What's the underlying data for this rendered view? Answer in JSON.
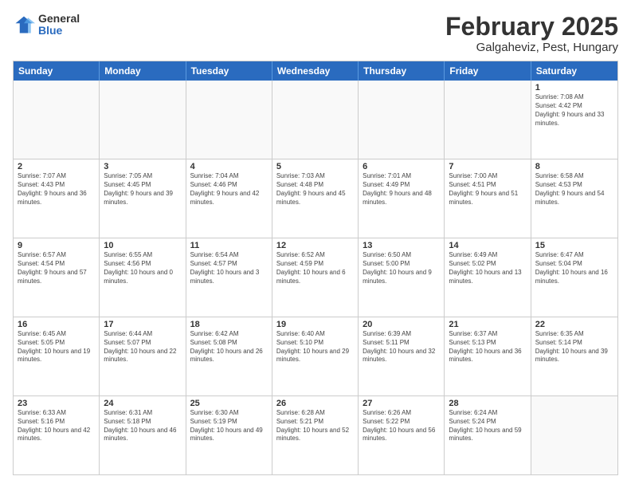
{
  "logo": {
    "general": "General",
    "blue": "Blue"
  },
  "title": "February 2025",
  "location": "Galgaheviz, Pest, Hungary",
  "days_of_week": [
    "Sunday",
    "Monday",
    "Tuesday",
    "Wednesday",
    "Thursday",
    "Friday",
    "Saturday"
  ],
  "weeks": [
    [
      {
        "day": "",
        "info": ""
      },
      {
        "day": "",
        "info": ""
      },
      {
        "day": "",
        "info": ""
      },
      {
        "day": "",
        "info": ""
      },
      {
        "day": "",
        "info": ""
      },
      {
        "day": "",
        "info": ""
      },
      {
        "day": "1",
        "info": "Sunrise: 7:08 AM\nSunset: 4:42 PM\nDaylight: 9 hours and 33 minutes."
      }
    ],
    [
      {
        "day": "2",
        "info": "Sunrise: 7:07 AM\nSunset: 4:43 PM\nDaylight: 9 hours and 36 minutes."
      },
      {
        "day": "3",
        "info": "Sunrise: 7:05 AM\nSunset: 4:45 PM\nDaylight: 9 hours and 39 minutes."
      },
      {
        "day": "4",
        "info": "Sunrise: 7:04 AM\nSunset: 4:46 PM\nDaylight: 9 hours and 42 minutes."
      },
      {
        "day": "5",
        "info": "Sunrise: 7:03 AM\nSunset: 4:48 PM\nDaylight: 9 hours and 45 minutes."
      },
      {
        "day": "6",
        "info": "Sunrise: 7:01 AM\nSunset: 4:49 PM\nDaylight: 9 hours and 48 minutes."
      },
      {
        "day": "7",
        "info": "Sunrise: 7:00 AM\nSunset: 4:51 PM\nDaylight: 9 hours and 51 minutes."
      },
      {
        "day": "8",
        "info": "Sunrise: 6:58 AM\nSunset: 4:53 PM\nDaylight: 9 hours and 54 minutes."
      }
    ],
    [
      {
        "day": "9",
        "info": "Sunrise: 6:57 AM\nSunset: 4:54 PM\nDaylight: 9 hours and 57 minutes."
      },
      {
        "day": "10",
        "info": "Sunrise: 6:55 AM\nSunset: 4:56 PM\nDaylight: 10 hours and 0 minutes."
      },
      {
        "day": "11",
        "info": "Sunrise: 6:54 AM\nSunset: 4:57 PM\nDaylight: 10 hours and 3 minutes."
      },
      {
        "day": "12",
        "info": "Sunrise: 6:52 AM\nSunset: 4:59 PM\nDaylight: 10 hours and 6 minutes."
      },
      {
        "day": "13",
        "info": "Sunrise: 6:50 AM\nSunset: 5:00 PM\nDaylight: 10 hours and 9 minutes."
      },
      {
        "day": "14",
        "info": "Sunrise: 6:49 AM\nSunset: 5:02 PM\nDaylight: 10 hours and 13 minutes."
      },
      {
        "day": "15",
        "info": "Sunrise: 6:47 AM\nSunset: 5:04 PM\nDaylight: 10 hours and 16 minutes."
      }
    ],
    [
      {
        "day": "16",
        "info": "Sunrise: 6:45 AM\nSunset: 5:05 PM\nDaylight: 10 hours and 19 minutes."
      },
      {
        "day": "17",
        "info": "Sunrise: 6:44 AM\nSunset: 5:07 PM\nDaylight: 10 hours and 22 minutes."
      },
      {
        "day": "18",
        "info": "Sunrise: 6:42 AM\nSunset: 5:08 PM\nDaylight: 10 hours and 26 minutes."
      },
      {
        "day": "19",
        "info": "Sunrise: 6:40 AM\nSunset: 5:10 PM\nDaylight: 10 hours and 29 minutes."
      },
      {
        "day": "20",
        "info": "Sunrise: 6:39 AM\nSunset: 5:11 PM\nDaylight: 10 hours and 32 minutes."
      },
      {
        "day": "21",
        "info": "Sunrise: 6:37 AM\nSunset: 5:13 PM\nDaylight: 10 hours and 36 minutes."
      },
      {
        "day": "22",
        "info": "Sunrise: 6:35 AM\nSunset: 5:14 PM\nDaylight: 10 hours and 39 minutes."
      }
    ],
    [
      {
        "day": "23",
        "info": "Sunrise: 6:33 AM\nSunset: 5:16 PM\nDaylight: 10 hours and 42 minutes."
      },
      {
        "day": "24",
        "info": "Sunrise: 6:31 AM\nSunset: 5:18 PM\nDaylight: 10 hours and 46 minutes."
      },
      {
        "day": "25",
        "info": "Sunrise: 6:30 AM\nSunset: 5:19 PM\nDaylight: 10 hours and 49 minutes."
      },
      {
        "day": "26",
        "info": "Sunrise: 6:28 AM\nSunset: 5:21 PM\nDaylight: 10 hours and 52 minutes."
      },
      {
        "day": "27",
        "info": "Sunrise: 6:26 AM\nSunset: 5:22 PM\nDaylight: 10 hours and 56 minutes."
      },
      {
        "day": "28",
        "info": "Sunrise: 6:24 AM\nSunset: 5:24 PM\nDaylight: 10 hours and 59 minutes."
      },
      {
        "day": "",
        "info": ""
      }
    ]
  ]
}
